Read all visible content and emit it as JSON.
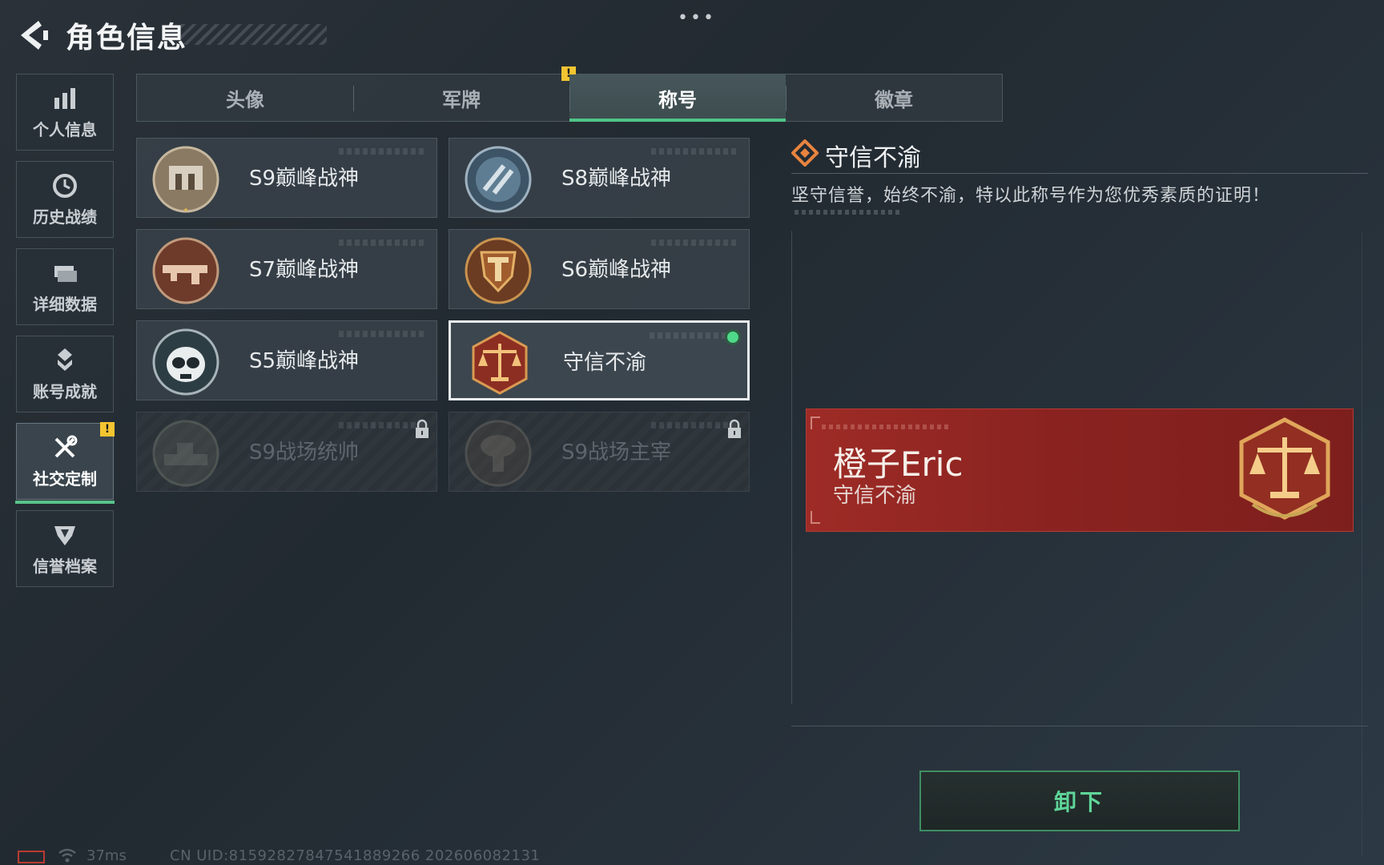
{
  "header": {
    "title": "角色信息",
    "more": "•••"
  },
  "sidebar": {
    "items": [
      {
        "label": "个人信息",
        "icon": "bar-chart-icon",
        "active": false
      },
      {
        "label": "历史战绩",
        "icon": "clock-icon",
        "active": false
      },
      {
        "label": "详细数据",
        "icon": "folder-icon",
        "active": false
      },
      {
        "label": "账号成就",
        "icon": "medal-icon",
        "active": false
      },
      {
        "label": "社交定制",
        "icon": "tools-icon",
        "active": true,
        "badge": "!"
      },
      {
        "label": "信誉档案",
        "icon": "shield-icon",
        "active": false
      }
    ]
  },
  "tabs": [
    {
      "label": "头像",
      "active": false
    },
    {
      "label": "军牌",
      "active": false,
      "badge": "!"
    },
    {
      "label": "称号",
      "active": true
    },
    {
      "label": "徽章",
      "active": false
    }
  ],
  "titles": [
    {
      "name": "S9巅峰战神",
      "state": "unlocked"
    },
    {
      "name": "S8巅峰战神",
      "state": "unlocked"
    },
    {
      "name": "S7巅峰战神",
      "state": "unlocked"
    },
    {
      "name": "S6巅峰战神",
      "state": "unlocked"
    },
    {
      "name": "S5巅峰战神",
      "state": "unlocked"
    },
    {
      "name": "守信不渝",
      "state": "selected-equipped"
    },
    {
      "name": "S9战场统帅",
      "state": "locked"
    },
    {
      "name": "S9战场主宰",
      "state": "locked"
    }
  ],
  "detail": {
    "title": "守信不渝",
    "description": "坚守信誉，始终不渝，特以此称号作为您优秀素质的证明！"
  },
  "nameplate": {
    "player": "橙子Eric",
    "title": "守信不渝"
  },
  "actions": {
    "unequip": "卸下"
  },
  "status": {
    "ping": "37ms",
    "uid": "CN UID:815928278475418892​66 202606082131"
  },
  "colors": {
    "accent": "#4fc487",
    "warn": "#f4c531",
    "nameplate": "#9e2b26"
  }
}
